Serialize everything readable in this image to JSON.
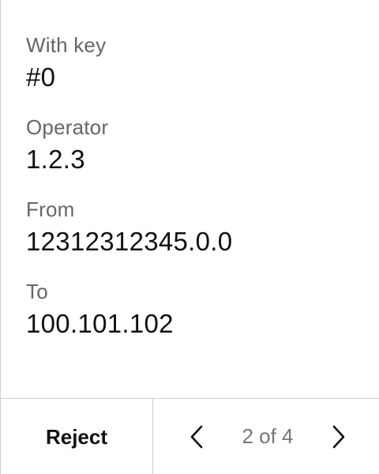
{
  "fields": [
    {
      "label": "With key",
      "value": "#0"
    },
    {
      "label": "Operator",
      "value": "1.2.3"
    },
    {
      "label": "From",
      "value": "12312312345.0.0"
    },
    {
      "label": "To",
      "value": "100.101.102"
    }
  ],
  "footer": {
    "reject_label": "Reject",
    "page_indicator": "2 of 4",
    "prev_icon": "chevron-left-icon",
    "next_icon": "chevron-right-icon"
  }
}
